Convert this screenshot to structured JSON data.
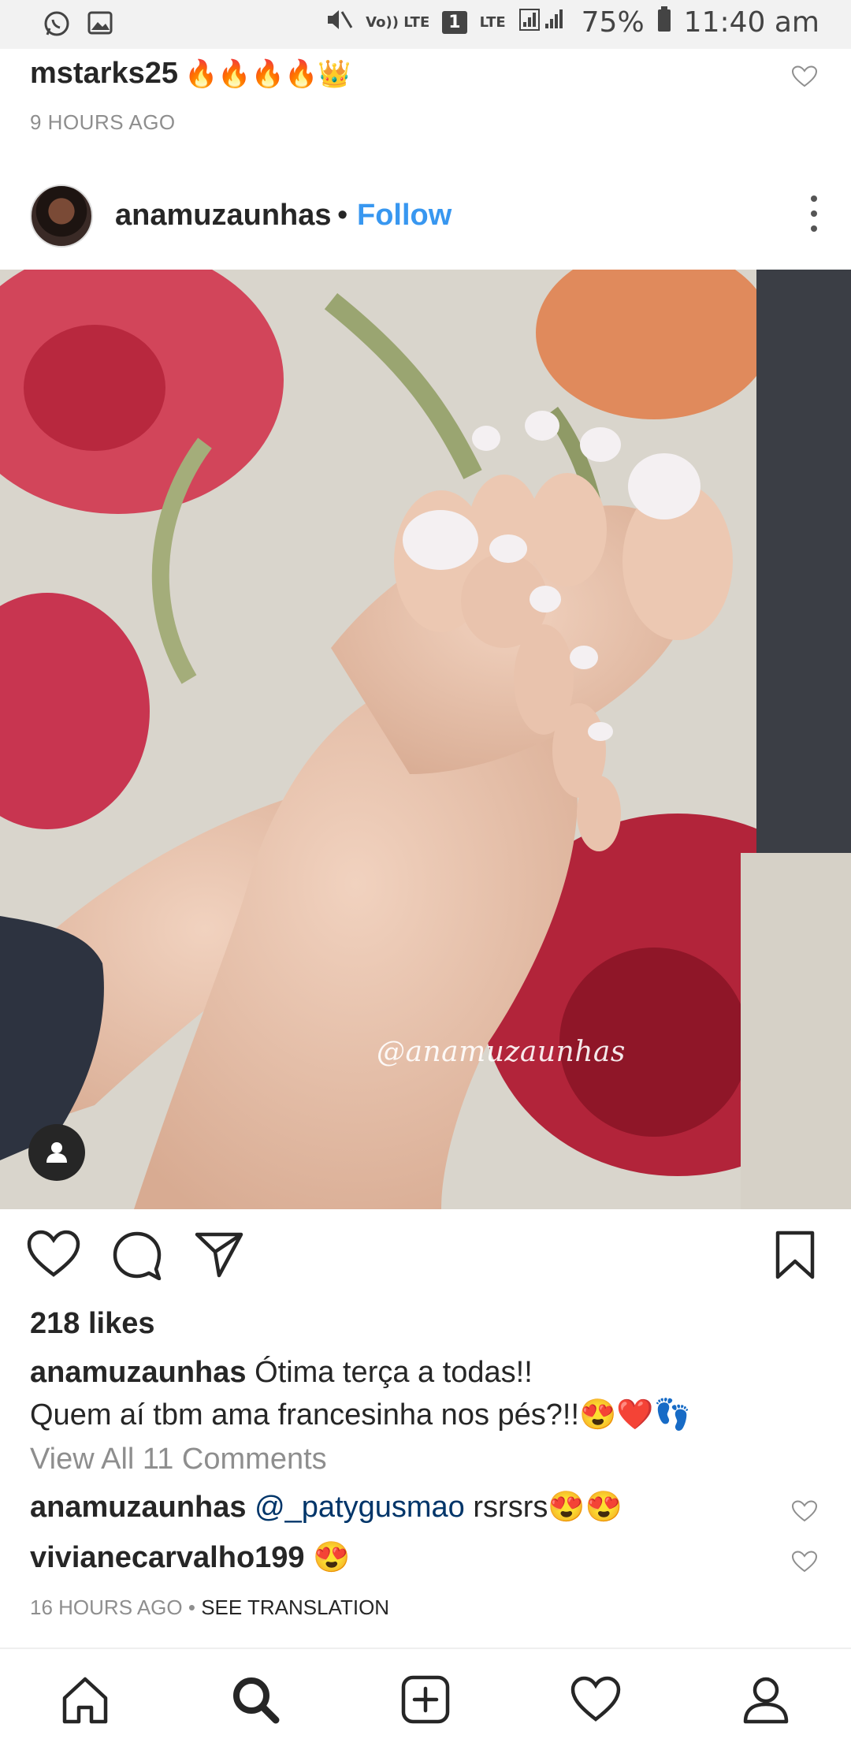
{
  "status_bar": {
    "volte_label": "Vo)) LTE",
    "sim_label": "1",
    "lte_label": "LTE",
    "battery": "75%",
    "time": "11:40 am"
  },
  "previous_comment": {
    "username": "mstarks25",
    "emoji": "🔥🔥🔥🔥👑",
    "time": "9 HOURS AGO"
  },
  "post": {
    "username": "anamuzaunhas",
    "separator": "•",
    "follow_label": "Follow",
    "image_watermark": "@anamuzaunhas",
    "likes": "218 likes",
    "caption_user": "anamuzaunhas",
    "caption_text_1": "Ótima terça a todas!!",
    "caption_text_2": "Quem aí tbm ama francesinha nos pés?!!😍❤️👣",
    "view_all": "View All 11 Comments",
    "comments": [
      {
        "user": "anamuzaunhas",
        "mention": "@_patygusmao",
        "text": "rsrsrs😍😍"
      },
      {
        "user": "vivianecarvalho199",
        "mention": "",
        "text": "😍"
      }
    ],
    "time": "16 HOURS AGO",
    "meta_separator": "•",
    "translation_label": "SEE TRANSLATION"
  },
  "icons": {
    "status_left": [
      "whatsapp-icon",
      "gallery-icon"
    ],
    "actions": [
      "heart-icon",
      "comment-icon",
      "share-icon",
      "bookmark-icon"
    ],
    "nav": [
      "home-icon",
      "search-icon",
      "add-icon",
      "activity-icon",
      "profile-icon"
    ]
  },
  "colors": {
    "follow": "#3897f0",
    "mention": "#003569",
    "secondary_text": "#8e8e8e",
    "primary_text": "#262626"
  }
}
